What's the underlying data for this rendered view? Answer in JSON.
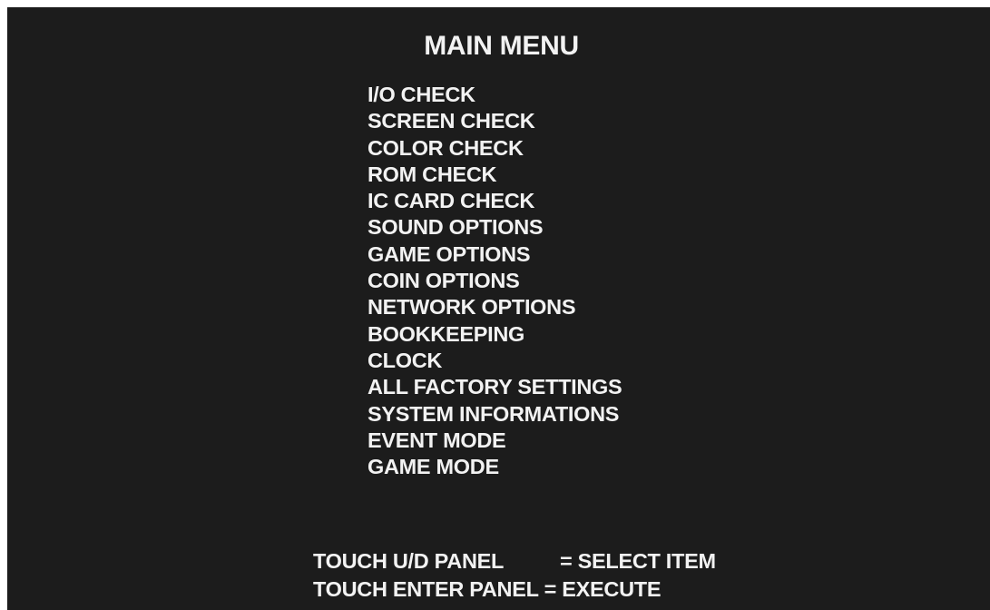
{
  "title": "MAIN MENU",
  "menu": {
    "items": [
      {
        "label": "I/O CHECK"
      },
      {
        "label": "SCREEN CHECK"
      },
      {
        "label": "COLOR CHECK"
      },
      {
        "label": "ROM CHECK"
      },
      {
        "label": "IC CARD CHECK"
      },
      {
        "label": "SOUND OPTIONS"
      },
      {
        "label": "GAME OPTIONS"
      },
      {
        "label": "COIN OPTIONS"
      },
      {
        "label": "NETWORK OPTIONS"
      },
      {
        "label": "BOOKKEEPING"
      },
      {
        "label": "CLOCK"
      },
      {
        "label": "ALL FACTORY SETTINGS"
      },
      {
        "label": "SYSTEM INFORMATIONS"
      },
      {
        "label": "EVENT MODE"
      },
      {
        "label": "GAME MODE"
      }
    ]
  },
  "help": [
    {
      "key": "TOUCH U/D PANEL",
      "action": "= SELECT ITEM"
    },
    {
      "key": "TOUCH ENTER PANEL",
      "action": "= EXECUTE"
    }
  ],
  "colors": {
    "background": "#1c1c1c",
    "text": "#f2f2f2",
    "frame": "#ffffff"
  }
}
